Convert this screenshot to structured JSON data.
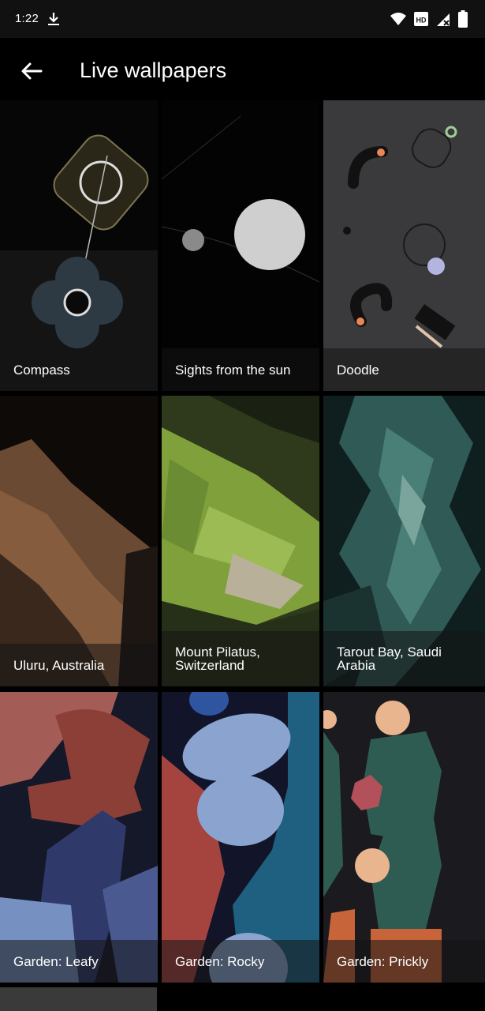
{
  "status_bar": {
    "time": "1:22",
    "icons": [
      "download-icon",
      "wifi-icon",
      "hd-icon",
      "signal-icon",
      "battery-icon"
    ],
    "hd_label": "HD"
  },
  "app_bar": {
    "title": "Live wallpapers",
    "back_icon": "arrow-back-icon"
  },
  "wallpapers": [
    {
      "label": "Compass"
    },
    {
      "label": "Sights from the sun"
    },
    {
      "label": "Doodle"
    },
    {
      "label": "Uluru, Australia"
    },
    {
      "label": "Mount Pilatus, Switzerland"
    },
    {
      "label": "Tarout Bay, Saudi Arabia"
    },
    {
      "label": "Garden: Leafy"
    },
    {
      "label": "Garden: Rocky"
    },
    {
      "label": "Garden: Prickly"
    }
  ],
  "colors": {
    "background": "#000000",
    "status_bar": "#111111",
    "label_overlay": "rgba(20,20,20,0.55)"
  }
}
